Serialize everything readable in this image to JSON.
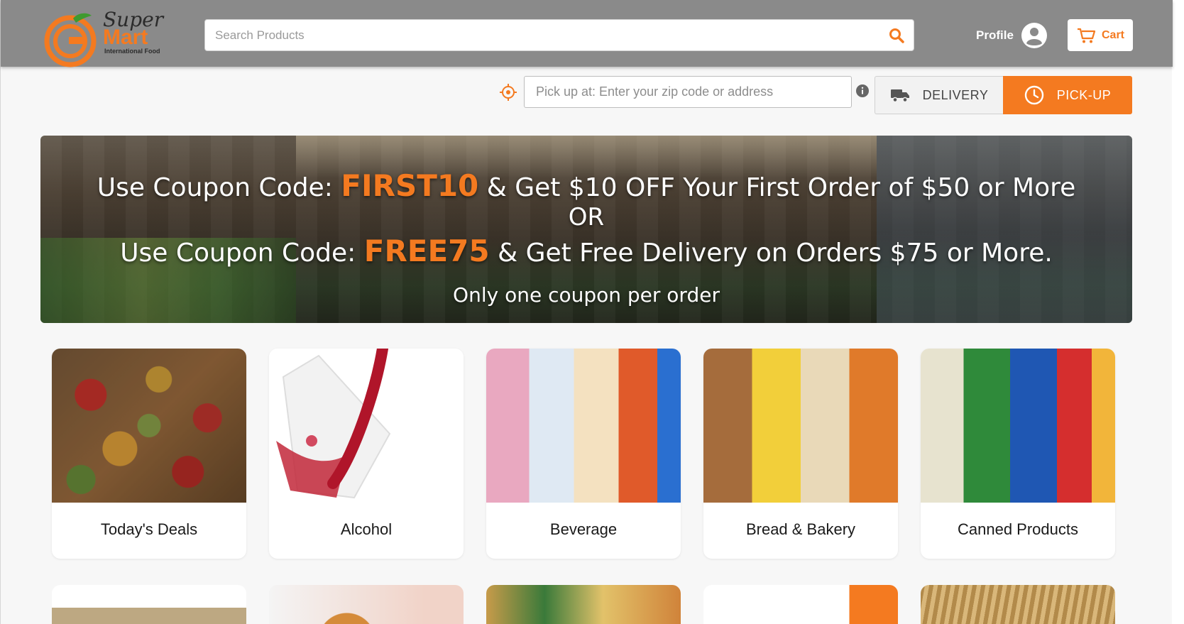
{
  "header": {
    "logo": {
      "line1": "Super",
      "line2": "Mart",
      "line3": "International Food"
    },
    "search": {
      "placeholder": "Search Products",
      "value": ""
    },
    "profile_label": "Profile",
    "cart_label": "Cart"
  },
  "location": {
    "placeholder": "Pick up at: Enter your zip code or address",
    "value": "",
    "options": [
      {
        "label": "DELIVERY",
        "icon": "truck-icon",
        "selected": false
      },
      {
        "label": "PICK-UP",
        "icon": "clock-icon",
        "selected": true
      }
    ]
  },
  "banner": {
    "line1_prefix": "Use Coupon Code:",
    "code1": "FIRST10",
    "line1_suffix": "& Get $10 OFF Your First Order of $50 or More",
    "or": "OR",
    "line3_prefix": "Use Coupon Code:",
    "code2": "FREE75",
    "line3_suffix": "& Get Free Delivery on Orders $75 or More.",
    "note": "Only one coupon per order"
  },
  "categories": [
    {
      "label": "Today's Deals"
    },
    {
      "label": "Alcohol"
    },
    {
      "label": "Beverage"
    },
    {
      "label": "Bread & Bakery"
    },
    {
      "label": "Canned Products"
    }
  ],
  "colors": {
    "accent": "#f47a20",
    "header_bg": "#8a8a8a",
    "page_bg": "#f7f7f7"
  }
}
